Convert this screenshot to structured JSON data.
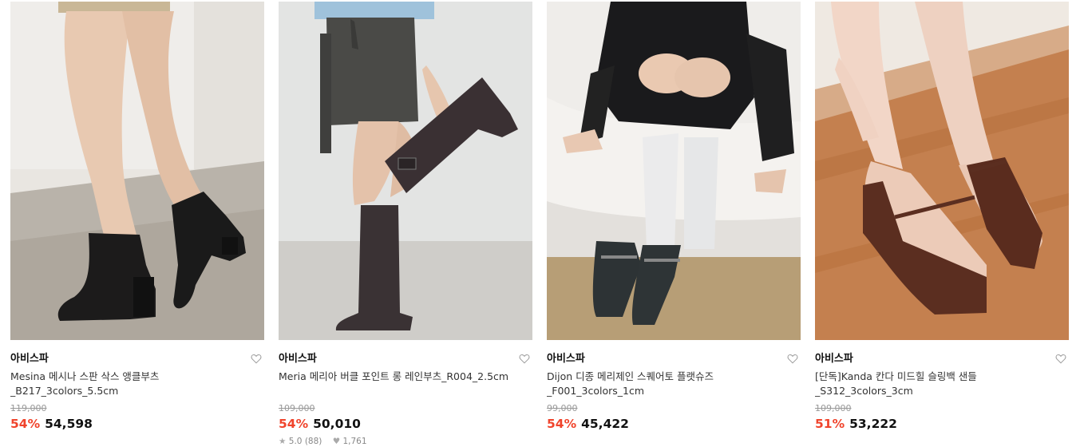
{
  "products": [
    {
      "brand": "아비스파",
      "title_line1": "Mesina 메시나 스판 삭스 앵클부츠",
      "title_line2": "_B217_3colors_5.5cm",
      "original_price": "119,000",
      "discount": "54%",
      "price": "54,598",
      "image": "black-ankle-boots-photo"
    },
    {
      "brand": "아비스파",
      "title_line1": "Meria 메리아 버클 포인트 롱 레인부츠_R004_2.5cm",
      "title_line2": "",
      "original_price": "109,000",
      "discount": "54%",
      "price": "50,010",
      "rating": "5.0",
      "review_count": "(88)",
      "likes": "1,761",
      "image": "long-rain-boots-photo"
    },
    {
      "brand": "아비스파",
      "title_line1": "Dijon 디종 메리제인 스퀘어토 플랫슈즈",
      "title_line2": "_F001_3colors_1cm",
      "original_price": "99,000",
      "discount": "54%",
      "price": "45,422",
      "image": "mary-jane-flats-photo"
    },
    {
      "brand": "아비스파",
      "title_line1": "[단독]Kanda 칸다 미드힐 슬링백 샌들",
      "title_line2": "_S312_3colors_3cm",
      "original_price": "109,000",
      "discount": "51%",
      "price": "53,222",
      "image": "slingback-sandals-photo"
    }
  ],
  "colors": {
    "discount": "#f0442c",
    "price": "#111111",
    "strikethrough": "#999999",
    "icon": "#aaaaaa"
  },
  "icons": {
    "wishlist": "heart-outline-icon",
    "rating": "star-icon",
    "likes": "heart-filled-icon"
  }
}
